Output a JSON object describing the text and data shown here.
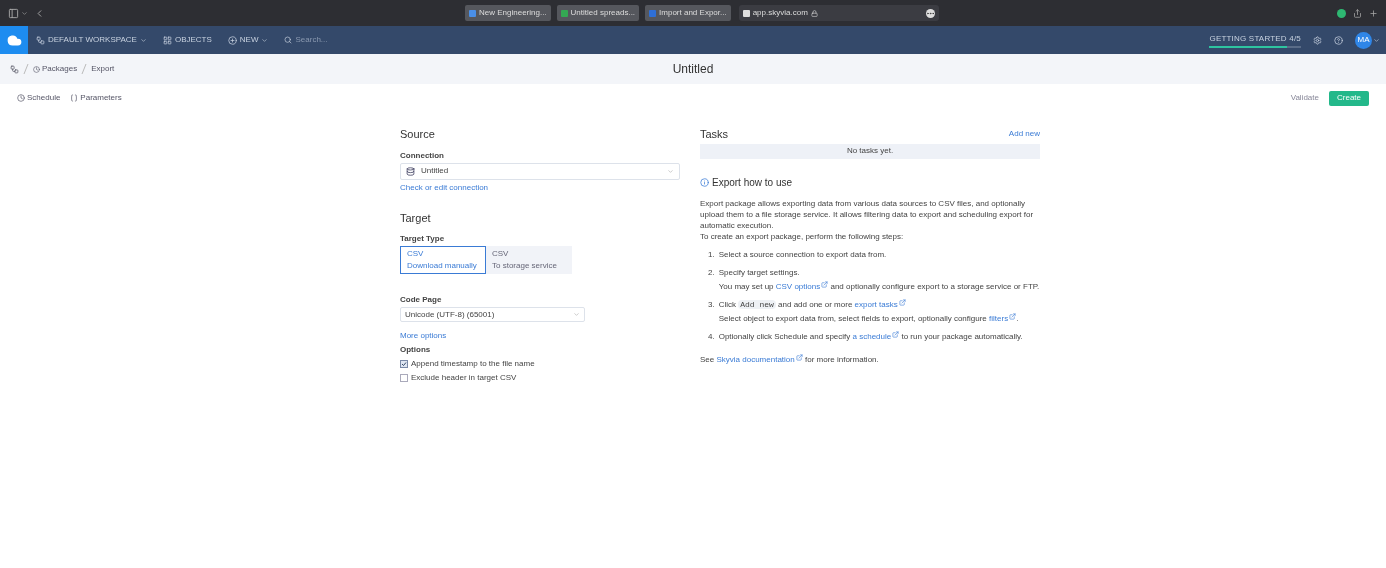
{
  "browser": {
    "tabs": [
      {
        "title": "New Engineering...",
        "color": "#4a8fe7"
      },
      {
        "title": "Untitled spreads...",
        "color": "#34a853"
      },
      {
        "title": "Import and Expor...",
        "color": "#2f6fd6"
      }
    ],
    "address": "app.skyvia.com"
  },
  "nav": {
    "workspace": "DEFAULT WORKSPACE",
    "items": [
      {
        "label": "OBJECTS",
        "kind": "grid"
      },
      {
        "label": "NEW",
        "kind": "new"
      }
    ],
    "search_placeholder": "Search...",
    "getting_started": {
      "label": "GETTING STARTED 4/5",
      "level": 0.85
    },
    "avatar": "MA"
  },
  "breadcrumb": [
    "Packages",
    "Export"
  ],
  "title": "Untitled",
  "toolbar": {
    "left": [
      {
        "label": "Schedule",
        "kind": "clock"
      },
      {
        "label": "Parameters",
        "kind": "params"
      }
    ],
    "validate": "Validate",
    "create": "Create"
  },
  "source": {
    "heading": "Source",
    "connection_label": "Connection",
    "connection": "Untitled",
    "edit_link": "Check or edit connection"
  },
  "target": {
    "heading": "Target",
    "type_label": "Target Type",
    "types": [
      {
        "title": "CSV",
        "subtitle": "Download manually",
        "selected": true
      },
      {
        "title": "CSV",
        "subtitle": "To storage service",
        "selected": false
      }
    ],
    "code_page_label": "Code Page",
    "code_page": "Unicode (UTF-8) (65001)",
    "more_options": "More options",
    "options_label": "Options",
    "options": [
      {
        "label": "Append timestamp to the file name",
        "checked": true
      },
      {
        "label": "Exclude header in target CSV",
        "checked": false
      }
    ]
  },
  "tasks": {
    "heading": "Tasks",
    "add": "Add new",
    "empty": "No tasks yet."
  },
  "help": {
    "heading": "Export how to use",
    "intro": "Export package allows exporting data from various data sources to CSV files, and optionally upload them to a file storage service. It allows filtering data to export and scheduling export for automatic execution.",
    "lead": "To create an export package, perform the following steps:",
    "steps": [
      {
        "num": "1.",
        "main": [
          {
            "kind": "text",
            "text": "Select a source connection to export data from."
          }
        ]
      },
      {
        "num": "2.",
        "main": [
          {
            "kind": "text",
            "text": "Specify target settings."
          }
        ],
        "sub": [
          {
            "kind": "text",
            "text": "You may set up "
          },
          {
            "kind": "link",
            "text": "CSV options"
          },
          {
            "kind": "text",
            "text": " and optionally configure export to a storage service or FTP."
          }
        ]
      },
      {
        "num": "3.",
        "main": [
          {
            "kind": "text",
            "text": "Click "
          },
          {
            "kind": "code",
            "text": "Add new"
          },
          {
            "kind": "text",
            "text": " and add one or more "
          },
          {
            "kind": "link",
            "text": "export tasks"
          }
        ],
        "sub": [
          {
            "kind": "text",
            "text": "Select object to export data from, select fields to export, optionally configure "
          },
          {
            "kind": "link",
            "text": "filters"
          },
          {
            "kind": "text",
            "text": "."
          }
        ]
      },
      {
        "num": "4.",
        "main": [
          {
            "kind": "text",
            "text": "Optionally click Schedule and specify "
          },
          {
            "kind": "link",
            "text": "a schedule"
          },
          {
            "kind": "text",
            "text": " to run your package automatically."
          }
        ]
      }
    ],
    "footer": [
      {
        "kind": "text",
        "text": "See "
      },
      {
        "kind": "link",
        "text": "Skyvia documentation"
      },
      {
        "kind": "text",
        "text": " for more information."
      }
    ]
  }
}
